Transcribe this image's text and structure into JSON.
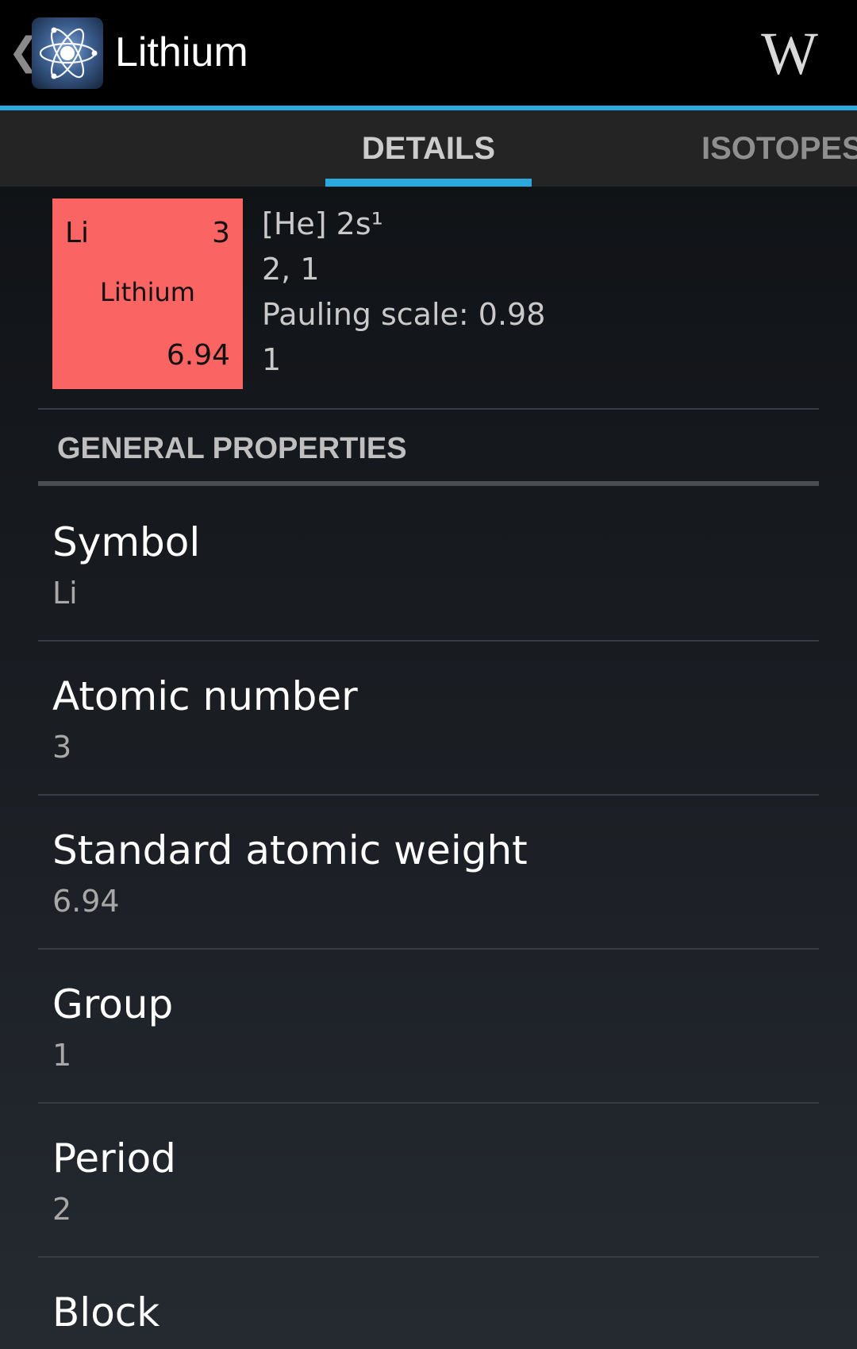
{
  "action_bar": {
    "title": "Lithium",
    "up_glyph": "❮",
    "app_icon": "atom-icon",
    "wiki_label": "W",
    "accent_color": "#2aa9e0"
  },
  "tabs": [
    {
      "label": "DETAILS",
      "selected": true
    },
    {
      "label": "ISOTOPES",
      "selected": false
    }
  ],
  "element_tile": {
    "symbol": "Li",
    "atomic_number": "3",
    "name": "Lithium",
    "weight": "6.94",
    "color": "#fa6462"
  },
  "summary": [
    "[He] 2s¹",
    "2, 1",
    "Pauling scale: 0.98",
    "1"
  ],
  "section": {
    "title": "GENERAL PROPERTIES"
  },
  "properties": [
    {
      "label": "Symbol",
      "value": "Li"
    },
    {
      "label": "Atomic number",
      "value": "3"
    },
    {
      "label": "Standard atomic weight",
      "value": "6.94"
    },
    {
      "label": "Group",
      "value": "1"
    },
    {
      "label": "Period",
      "value": "2"
    },
    {
      "label": "Block",
      "value": ""
    }
  ]
}
